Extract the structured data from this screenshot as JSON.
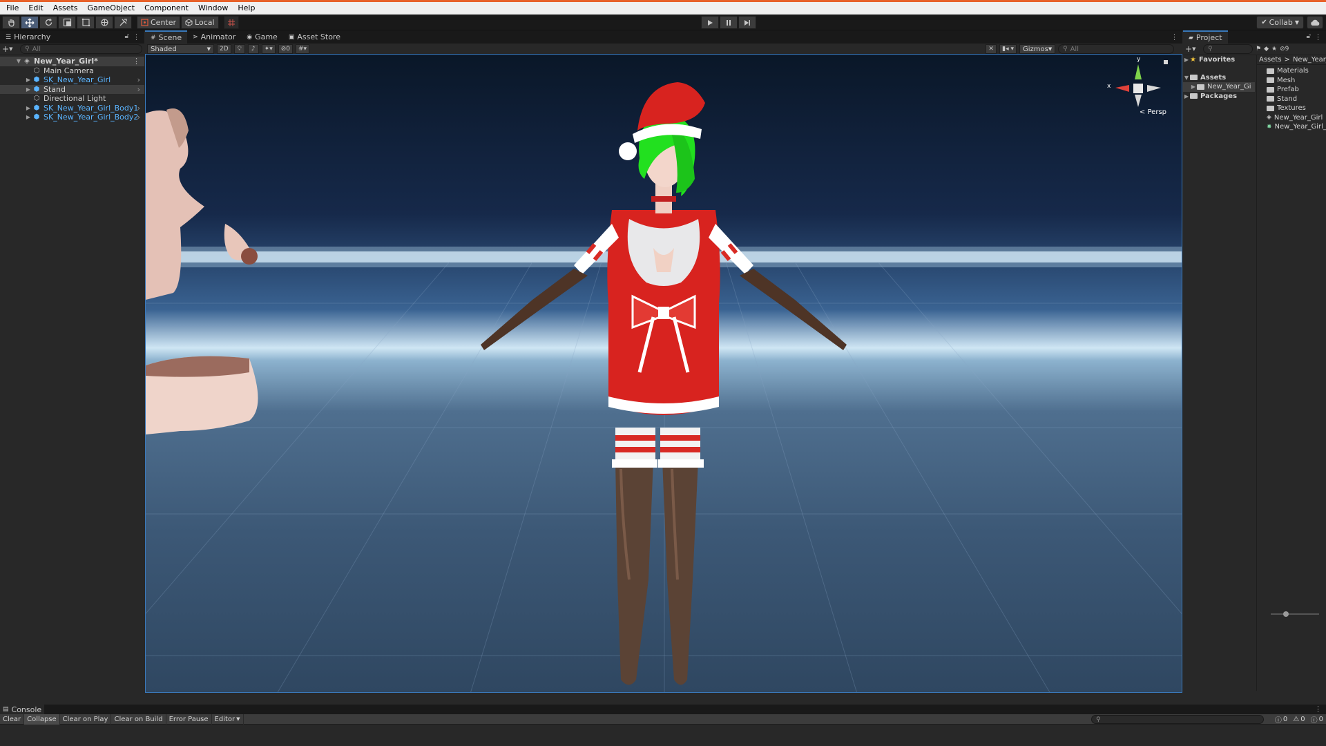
{
  "menubar": [
    "File",
    "Edit",
    "Assets",
    "GameObject",
    "Component",
    "Window",
    "Help"
  ],
  "toolbar": {
    "pivot_center": "Center",
    "pivot_local": "Local",
    "collab": "Collab",
    "tools": [
      "hand-tool-icon",
      "move-tool-icon",
      "rotate-tool-icon",
      "scale-tool-icon",
      "rect-tool-icon",
      "transform-tool-icon",
      "custom-tool-icon"
    ],
    "accent_color": "#e8622a"
  },
  "hierarchy": {
    "title": "Hierarchy",
    "search_placeholder": "All",
    "items": [
      {
        "label": "New_Year_Girl*",
        "kind": "scene"
      },
      {
        "label": "Main Camera",
        "kind": "gameobject"
      },
      {
        "label": "SK_New_Year_Girl",
        "kind": "prefab"
      },
      {
        "label": "Stand",
        "kind": "prefab"
      },
      {
        "label": "Directional Light",
        "kind": "gameobject"
      },
      {
        "label": "SK_New_Year_Girl_Body1",
        "kind": "prefab"
      },
      {
        "label": "SK_New_Year_Girl_Body2",
        "kind": "prefab"
      }
    ]
  },
  "scene": {
    "tabs": [
      "Scene",
      "Animator",
      "Game",
      "Asset Store"
    ],
    "shading": "Shaded",
    "mode_2d": "2D",
    "hidden_count": "0",
    "gizmos": "Gizmos",
    "search_placeholder": "All",
    "persp_label": "Persp",
    "axis_y": "y",
    "axis_x": "x"
  },
  "project": {
    "title": "Project",
    "favorites": "Favorites",
    "assets": "Assets",
    "asset_child": "New_Year_Gi",
    "packages": "Packages",
    "breadcrumb_root": "Assets",
    "breadcrumb_sep": ">",
    "breadcrumb_leaf": "New_Year_",
    "items": [
      "Materials",
      "Mesh",
      "Prefab",
      "Stand",
      "Textures",
      "New_Year_Girl",
      "New_Year_Girl_"
    ],
    "hidden_count": "9"
  },
  "console": {
    "title": "Console",
    "buttons": [
      "Clear",
      "Collapse",
      "Clear on Play",
      "Clear on Build",
      "Error Pause",
      "Editor"
    ],
    "counts": [
      "0",
      "0",
      "0"
    ]
  }
}
